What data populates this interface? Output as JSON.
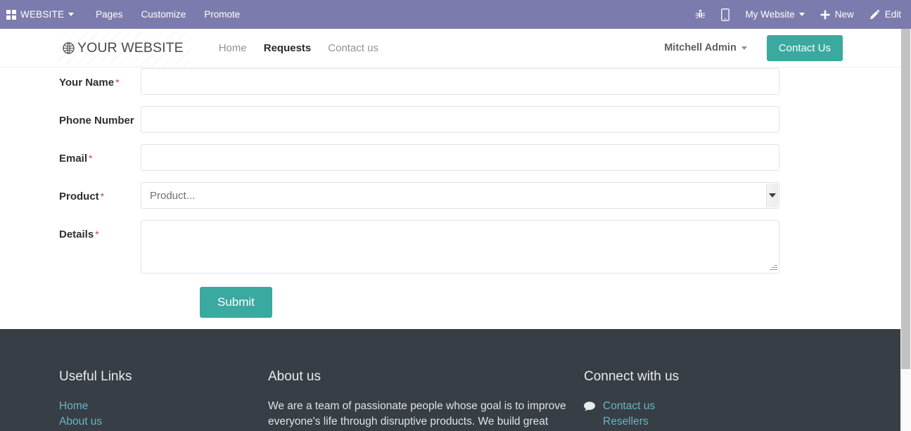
{
  "odoo_bar": {
    "apps_icon": "apps-grid-icon",
    "brand": "WEBSITE",
    "menu": [
      "Pages",
      "Customize",
      "Promote"
    ],
    "icons": {
      "debug": "bug-icon",
      "mobile": "mobile-preview-icon",
      "new": "plus-icon",
      "edit": "pencil-icon"
    },
    "site_selector": "My Website",
    "new_label": "New",
    "edit_label": "Edit",
    "bg_color": "#7c7bad"
  },
  "site_header": {
    "logo_icon": "globe-icon",
    "logo_text": "YOUR WEBSITE",
    "nav": [
      {
        "label": "Home",
        "active": false
      },
      {
        "label": "Requests",
        "active": true
      },
      {
        "label": "Contact us",
        "active": false
      }
    ],
    "user": "Mitchell Admin",
    "cta_label": "Contact Us",
    "accent_color": "#3aa9a0"
  },
  "form": {
    "fields": [
      {
        "label": "Your Name",
        "required": true,
        "type": "text",
        "value": "",
        "placeholder": ""
      },
      {
        "label": "Phone Number",
        "required": false,
        "type": "text",
        "value": "",
        "placeholder": ""
      },
      {
        "label": "Email",
        "required": true,
        "type": "text",
        "value": "",
        "placeholder": ""
      },
      {
        "label": "Product",
        "required": true,
        "type": "select",
        "value": "Product...",
        "placeholder": "Product..."
      },
      {
        "label": "Details",
        "required": true,
        "type": "textarea",
        "value": "",
        "placeholder": ""
      }
    ],
    "required_mark": "*",
    "submit_label": "Submit"
  },
  "footer": {
    "bg_color": "#383e45",
    "link_color": "#69b5c4",
    "columns": {
      "useful_links": {
        "heading": "Useful Links",
        "links": [
          "Home",
          "About us"
        ]
      },
      "about": {
        "heading": "About us",
        "text": "We are a team of passionate people whose goal is to improve everyone's life through disruptive products. We build great"
      },
      "connect": {
        "heading": "Connect with us",
        "contact_icon": "comment-bubble-icon",
        "links": [
          "Contact us",
          "Resellers"
        ]
      }
    }
  },
  "scrollbar": {
    "name": "vertical-scrollbar"
  }
}
